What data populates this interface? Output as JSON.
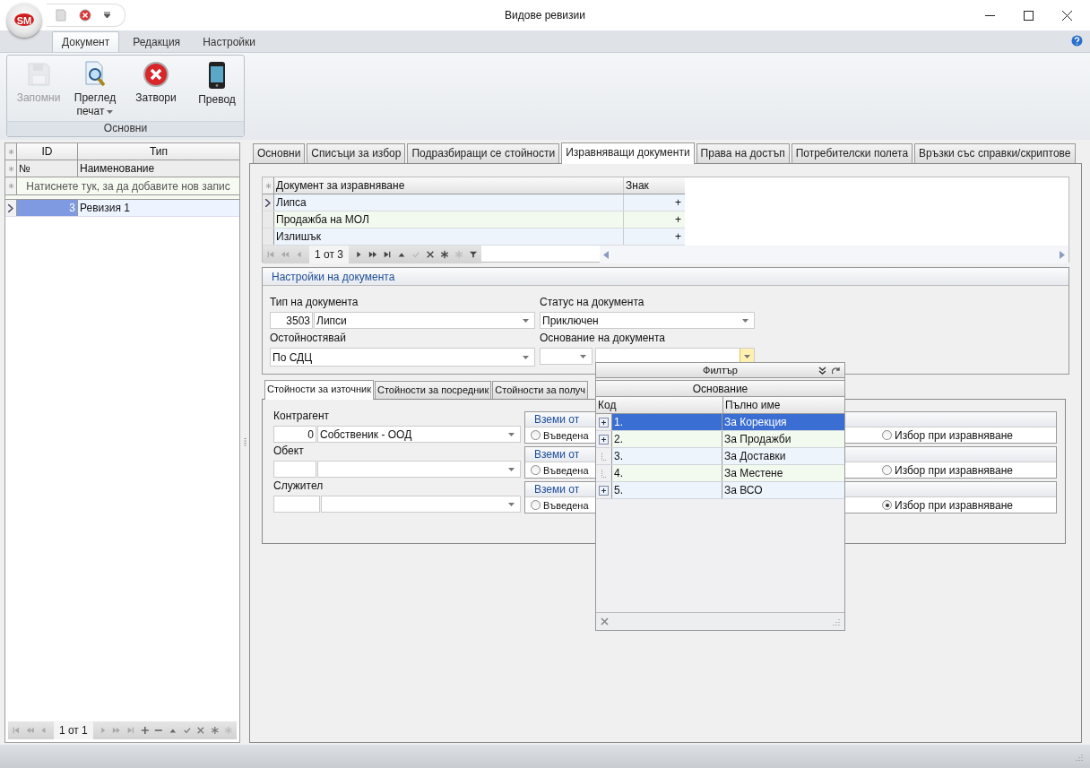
{
  "window": {
    "title": "Видове ревизии",
    "logo": "SM"
  },
  "ribbon": {
    "tabs": [
      {
        "label": "Документ",
        "selected": true
      },
      {
        "label": "Редакция",
        "selected": false
      },
      {
        "label": "Настройки",
        "selected": false
      }
    ],
    "group": {
      "label": "Основни",
      "buttons": [
        {
          "kind": "save",
          "label": "Запомни",
          "disabled": true,
          "dropdown": false
        },
        {
          "kind": "preview",
          "label": "Преглед печат",
          "disabled": false,
          "dropdown": true
        },
        {
          "kind": "close",
          "label": "Затвори",
          "disabled": false,
          "dropdown": false
        },
        {
          "kind": "phone",
          "label": "Превод",
          "disabled": false,
          "dropdown": false
        }
      ]
    }
  },
  "list": {
    "columns": [
      "ID",
      "Тип"
    ],
    "filter_row": [
      "№",
      "Наименование"
    ],
    "new_row_prompt": "Натиснете тук, за да добавите нов запис",
    "rows": [
      {
        "id": "3",
        "name": "Ревизия 1",
        "selected": true
      }
    ],
    "navigator": "1 от 1"
  },
  "tabs": [
    {
      "label": "Основни",
      "selected": false
    },
    {
      "label": "Списъци за избор",
      "selected": false
    },
    {
      "label": "Подразбиращи се стойности",
      "selected": false
    },
    {
      "label": "Изравняващи документи",
      "selected": true
    },
    {
      "label": "Права на достъп",
      "selected": false
    },
    {
      "label": "Потребителски полета",
      "selected": false
    },
    {
      "label": "Връзки със справки/скриптове",
      "selected": false
    }
  ],
  "compare_grid": {
    "columns": [
      "Документ за изравняване",
      "Знак"
    ],
    "rows": [
      {
        "document": "Липса",
        "sign": "+",
        "selected": true
      },
      {
        "document": "Продажба на МОЛ",
        "sign": "+",
        "selected": false
      },
      {
        "document": "Излишък",
        "sign": "+",
        "selected": false
      }
    ],
    "navigator": "1 от 3"
  },
  "settings": {
    "title": "Настройки на документа",
    "doc_type": {
      "label": "Тип на документа",
      "code": "3503",
      "value": "Липси"
    },
    "status": {
      "label": "Статус на документа",
      "value": "Приключен"
    },
    "valuation": {
      "label": "Остойностявай",
      "value": "По СДЦ"
    },
    "basis": {
      "label": "Основание на документа"
    }
  },
  "sub_tabs": [
    {
      "label": "Стойности за източник",
      "selected": true
    },
    {
      "label": "Стойности за посредник",
      "selected": false
    },
    {
      "label": "Стойности за получ",
      "selected": false
    }
  ],
  "source_fields": [
    {
      "label": "Контрагент",
      "code": "0",
      "value": "Собственик - ООД",
      "take_from": "Вземи от",
      "entered": {
        "label": "Въведена",
        "checked": false
      },
      "choice": {
        "label": "Избор при изравняване",
        "checked": false
      }
    },
    {
      "label": "Обект",
      "take_from": "Вземи от",
      "entered": {
        "label": "Въведена",
        "checked": false
      },
      "choice": {
        "label": "Избор при изравняване",
        "checked": false
      }
    },
    {
      "label": "Служител",
      "take_from": "Вземи от",
      "entered": {
        "label": "Въведена",
        "checked": false
      },
      "choice": {
        "label": "Избор при изравняване",
        "checked": true
      }
    }
  ],
  "basis_dropdown": {
    "filter": "Филтър",
    "band": "Основание",
    "columns": [
      "Код",
      "Пълно име"
    ],
    "rows": [
      {
        "code": "1.",
        "name": "За Корекция",
        "selected": true,
        "expandable": true
      },
      {
        "code": "2.",
        "name": "За Продажби",
        "selected": false,
        "expandable": true
      },
      {
        "code": "3.",
        "name": "За Доставки",
        "selected": false,
        "expandable": false
      },
      {
        "code": "4.",
        "name": "За Местене",
        "selected": false,
        "expandable": false
      },
      {
        "code": "5.",
        "name": "За ВСО",
        "selected": false,
        "expandable": true
      }
    ]
  }
}
